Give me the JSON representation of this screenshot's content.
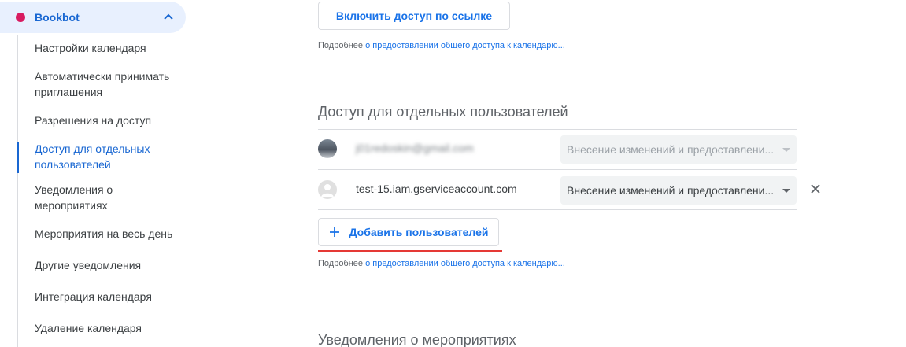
{
  "sidebar": {
    "calendar_name": "Bookbot",
    "calendar_color": "#d81b60",
    "items": [
      {
        "label": "Настройки календаря"
      },
      {
        "label": "Автоматически принимать приглашения"
      },
      {
        "label": "Разрешения на доступ"
      },
      {
        "label": "Доступ для отдельных пользователей",
        "active": true
      },
      {
        "label": "Уведомления о мероприятиях"
      },
      {
        "label": "Мероприятия на весь день"
      },
      {
        "label": "Другие уведомления"
      },
      {
        "label": "Интеграция календаря"
      },
      {
        "label": "Удаление календаря"
      }
    ]
  },
  "main": {
    "link_access_button": "Включить доступ по ссылке",
    "helper_prefix": "Подробнее",
    "helper_link": "о предоставлении общего доступа к календарю...",
    "sharing_section": {
      "title": "Доступ для отдельных пользователей",
      "users": [
        {
          "email": "j01redoskin@gmail.com",
          "permission": "Внесение изменений и предоставлени...",
          "disabled": true,
          "avatar": "photo"
        },
        {
          "email": "test-15.iam.gserviceaccount.com",
          "permission": "Внесение изменений и предоставлени...",
          "disabled": false,
          "avatar": "default-person"
        }
      ],
      "add_button": "Добавить пользователей"
    },
    "next_section_title": "Уведомления о мероприятиях"
  },
  "colors": {
    "accent": "#1a73e8",
    "highlight_underline": "#e53935"
  }
}
